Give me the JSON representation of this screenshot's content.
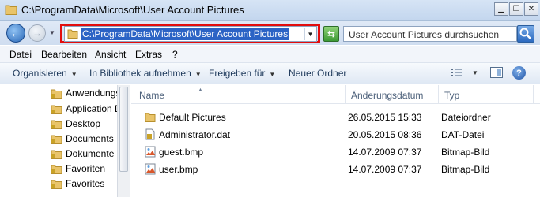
{
  "window": {
    "title": "C:\\ProgramData\\Microsoft\\User Account Pictures",
    "buttons": [
      "minimize",
      "maximize",
      "close"
    ]
  },
  "address_bar": {
    "path": "C:\\ProgramData\\Microsoft\\User Account Pictures",
    "highlight_color": "#e30d0d"
  },
  "search": {
    "placeholder": "User Account Pictures durchsuchen"
  },
  "menu": {
    "items": [
      "Datei",
      "Bearbeiten",
      "Ansicht",
      "Extras",
      "?"
    ]
  },
  "toolbar": {
    "organize": "Organisieren",
    "include_library": "In Bibliothek aufnehmen",
    "share": "Freigeben für",
    "new_folder": "Neuer Ordner"
  },
  "nav_pane": {
    "items": [
      "Anwendungs",
      "Application D",
      "Desktop",
      "Documents",
      "Dokumente",
      "Favoriten",
      "Favorites"
    ]
  },
  "columns": {
    "name": "Name",
    "date": "Änderungsdatum",
    "type": "Typ"
  },
  "files": [
    {
      "name": "Default Pictures",
      "date": "26.05.2015 15:33",
      "type": "Dateiordner",
      "icon": "folder-icon"
    },
    {
      "name": "Administrator.dat",
      "date": "20.05.2015 08:36",
      "type": "DAT-Datei",
      "icon": "dat-file-icon"
    },
    {
      "name": "guest.bmp",
      "date": "14.07.2009 07:37",
      "type": "Bitmap-Bild",
      "icon": "bitmap-icon"
    },
    {
      "name": "user.bmp",
      "date": "14.07.2009 07:37",
      "type": "Bitmap-Bild",
      "icon": "bitmap-icon"
    }
  ]
}
